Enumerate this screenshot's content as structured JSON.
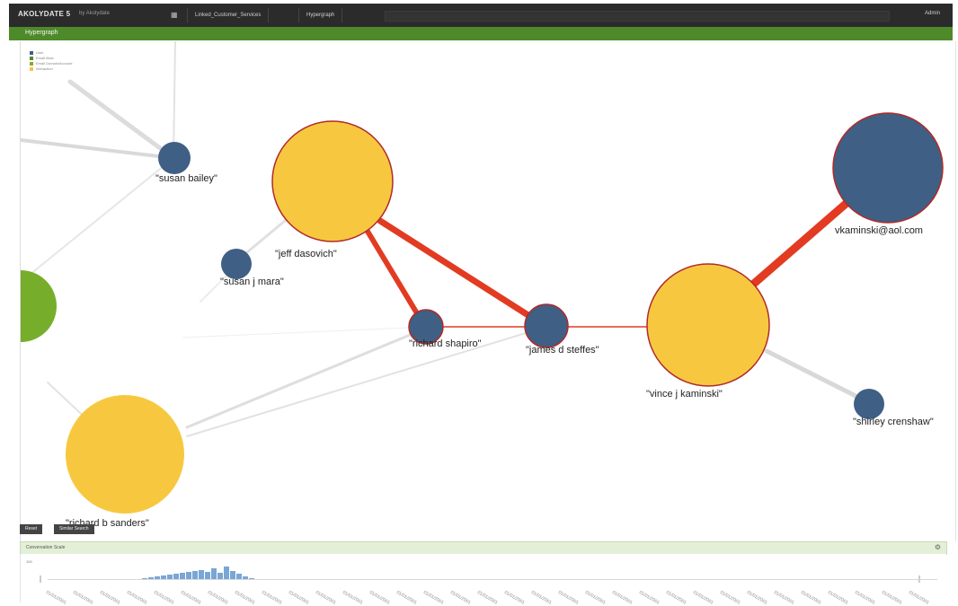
{
  "topbar": {
    "brand": "AKOLYDATE 5",
    "brand_sub": "by Akolydate",
    "tabs": [
      "Linked_Customer_Services",
      "Hypergraph"
    ],
    "admin": "Admin"
  },
  "titlebar": {
    "title": "Hypergraph"
  },
  "legend": [
    {
      "label": "User",
      "color": "#3d5f86"
    },
    {
      "label": "Email Alias",
      "color": "#55872a"
    },
    {
      "label": "Email Domain/Account",
      "color": "#8aa63a"
    },
    {
      "label": "Interaction",
      "color": "#f5c43b"
    }
  ],
  "graph": {
    "colors": {
      "blue": "#3f5f85",
      "yellow": "#f7c83f",
      "green": "#76ae2c",
      "red_edge": "#e23b22",
      "gray_edge": "#dedede"
    },
    "labels": {
      "susan_bailey": "\"susan bailey\"",
      "jeff_dasovich": "\"jeff dasovich\"",
      "susan_mara": "\"susan j mara\"",
      "richard_shapiro": "\"richard shapiro\"",
      "james_steffes": "\"james d steffes\"",
      "vince_kaminski": "\"vince j kaminski\"",
      "vkaminski_email": "vkaminski@aol.com",
      "shirley_crenshaw": "\"shirley crenshaw\"",
      "richard_sanders": "\"richard b sanders\""
    }
  },
  "buttons": {
    "reset": "Reset",
    "similar_search": "Similar Search"
  },
  "timeline": {
    "title": "Conversation Scale",
    "y_label": "100",
    "tick_label": "01/01/2001"
  }
}
